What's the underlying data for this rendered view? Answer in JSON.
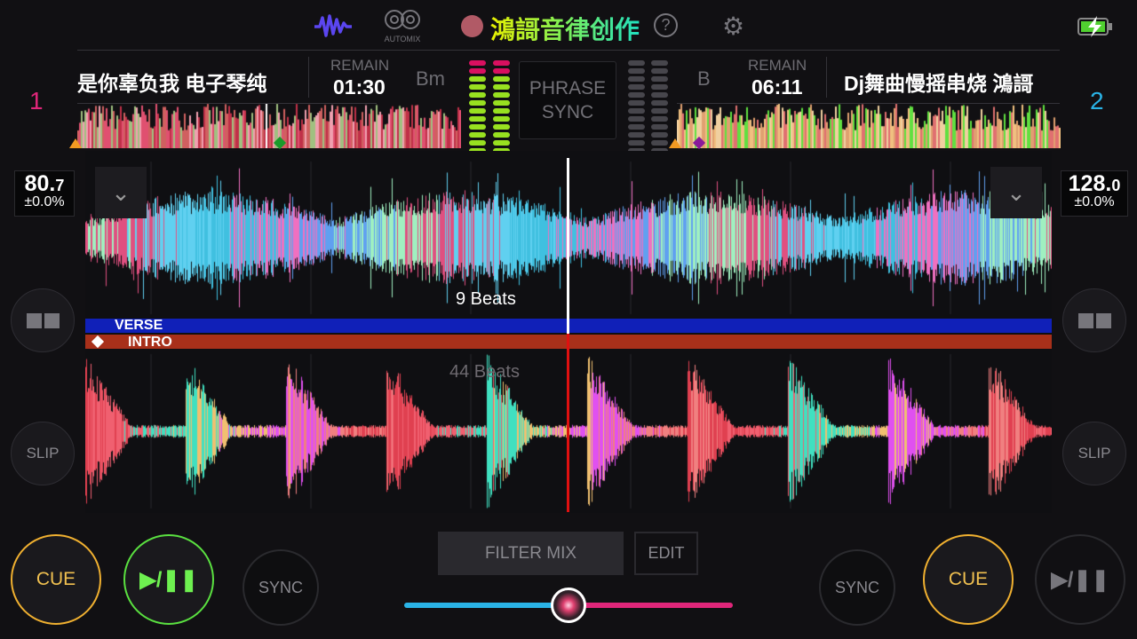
{
  "topbar": {
    "title": "鴻謌音律创作",
    "automix_label": "AUTOMIX",
    "icons": [
      "waveform-icon",
      "automix-icon",
      "record-icon",
      "help-icon",
      "gear-icon",
      "battery-charging-icon"
    ]
  },
  "deck1": {
    "number": "1",
    "title": "是你辜负我 电子琴纯",
    "remain_label": "REMAIN",
    "remain": "01:30",
    "key": "Bm",
    "bpm_int": "80.",
    "bpm_dec": "7",
    "pitch": "±0.0%",
    "color": "#e0267a"
  },
  "deck2": {
    "number": "2",
    "title": "Dj舞曲慢摇串烧 鴻謌",
    "remain_label": "REMAIN",
    "remain": "06:11",
    "key": "B",
    "bpm_int": "128.",
    "bpm_dec": "0",
    "pitch": "±0.0%",
    "color": "#2ab3e6"
  },
  "center": {
    "phrase_sync": "PHRASE SYNC",
    "upper_beats": "9 Beats",
    "lower_beats": "44 Beats",
    "phrase_upper": "VERSE",
    "phrase_lower": "INTRO"
  },
  "controls": {
    "cue": "CUE",
    "play": "▶/❚❚",
    "sync": "SYNC",
    "slip": "SLIP",
    "filter_mix": "FILTER MIX",
    "edit": "EDIT",
    "crossfader_position": 0.5
  }
}
